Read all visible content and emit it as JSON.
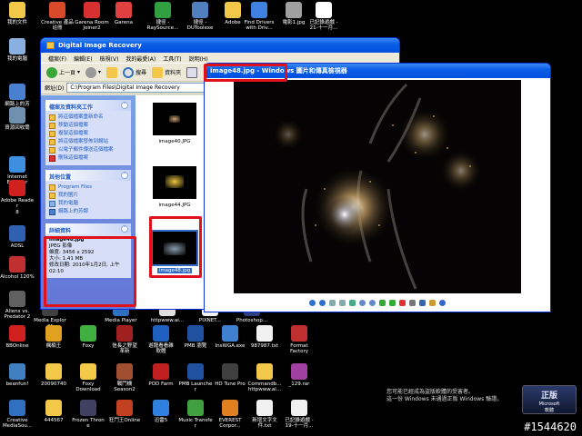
{
  "desktop": {
    "icons_top": [
      {
        "label": "我的文件",
        "color": "#f3c748",
        "icon": "folder-icon"
      },
      {
        "label": "Creative 產品\n註冊",
        "color": "#d84a2a",
        "icon": "creative-icon"
      },
      {
        "label": "Garena Room\nJoiner2",
        "color": "#d83030",
        "icon": "garena-icon"
      },
      {
        "label": "Garena",
        "color": "#e04040",
        "icon": "garena-icon"
      },
      {
        "label": "捷徑 -\nRaySource...",
        "color": "#30a040",
        "icon": "shortcut-icon"
      },
      {
        "label": "捷徑 -\nDUToolexe",
        "color": "#5080c0",
        "icon": "shortcut-icon"
      },
      {
        "label": "Adobe",
        "color": "#f3c748",
        "icon": "folder-icon"
      },
      {
        "label": "Find Drivers\nwith Driv...",
        "color": "#4080e0",
        "icon": "driver-icon"
      },
      {
        "label": "電影1.jpg",
        "color": "#a0a0a0",
        "icon": "image-file-icon"
      },
      {
        "label": "已記錄遊戲 -\n21-十一月...",
        "color": "#ffffff",
        "icon": "text-file-icon"
      }
    ],
    "icons_left": [
      {
        "label": "我的電腦",
        "color": "#8ab0e0",
        "icon": "computer-icon"
      },
      {
        "label": "網路上的芳\n鄰",
        "color": "#4a80d0",
        "icon": "network-icon"
      },
      {
        "label": "資源回收筒",
        "color": "#7090b0",
        "icon": "recycle-bin-icon"
      },
      {
        "label": "Internet\nExplorer",
        "color": "#3f8fe0",
        "icon": "ie-icon"
      },
      {
        "label": "Adobe Reader\n8",
        "color": "#d02020",
        "icon": "adobe-reader-icon"
      },
      {
        "label": "ADSL",
        "color": "#3060b0",
        "icon": "adsl-icon"
      },
      {
        "label": "Alcohol 120%",
        "color": "#c03030",
        "icon": "alcohol-icon"
      },
      {
        "label": "Aliens vs.\nPredator 2",
        "color": "#606060",
        "icon": "game-icon"
      }
    ],
    "icons_row1": [
      {
        "label": "Media Explorer",
        "color": "#404040",
        "icon": "media-explorer-icon"
      },
      {
        "label": "Media Player",
        "color": "#3070c0",
        "icon": "media-player-icon"
      },
      {
        "label": "httpwww.ai...",
        "color": "#e0e0e0",
        "icon": "web-shortcut-icon"
      },
      {
        "label": "PIXNET...",
        "color": "#f0f0f0",
        "icon": "shortcut-icon"
      },
      {
        "label": "Photoshop...",
        "color": "#304080",
        "icon": "photoshop-icon"
      }
    ],
    "icons_row2": [
      {
        "label": "BBOnline",
        "color": "#d02020",
        "icon": "bbonline-icon"
      },
      {
        "label": "楓楠王",
        "color": "#e0a020",
        "icon": "game-icon"
      },
      {
        "label": "Foxy",
        "color": "#40b040",
        "icon": "foxy-icon"
      },
      {
        "label": "信長之野望\n革新",
        "color": "#a02020",
        "icon": "game-icon"
      },
      {
        "label": "遊龍看看雜\n軟體",
        "color": "#2060c0",
        "icon": "game-icon"
      },
      {
        "label": "PMB 瀏覽",
        "color": "#2050a0",
        "icon": "pmb-icon"
      },
      {
        "label": "InsWGA.exe",
        "color": "#4080d0",
        "icon": "exe-icon"
      },
      {
        "label": "987987.txt",
        "color": "#f0f0f0",
        "icon": "text-file-icon"
      },
      {
        "label": "Format\nFactory",
        "color": "#c03030",
        "icon": "format-factory-icon"
      }
    ],
    "icons_row3": [
      {
        "label": "beanfun!",
        "color": "#4080c0",
        "icon": "beanfun-icon"
      },
      {
        "label": "20090740",
        "color": "#f3c748",
        "icon": "folder-icon"
      },
      {
        "label": "Foxy\nDownload",
        "color": "#f3c748",
        "icon": "folder-icon"
      },
      {
        "label": "戰鬥機\nSeason2",
        "color": "#a05030",
        "icon": "game-icon"
      },
      {
        "label": "POD Farm",
        "color": "#c02020",
        "icon": "pod-icon"
      },
      {
        "label": "PMB Launcher",
        "color": "#2050a0",
        "icon": "pmb-icon"
      },
      {
        "label": "HD Tune Pro",
        "color": "#404040",
        "icon": "hdtune-icon"
      },
      {
        "label": "Commandb...\nhttpwww.ai...",
        "color": "#f3c748",
        "icon": "folder-icon"
      },
      {
        "label": "_129.rar",
        "color": "#a040a0",
        "icon": "rar-icon"
      }
    ],
    "icons_row4": [
      {
        "label": "Creative\nMediaSou...",
        "color": "#3070c0",
        "icon": "creative-icon"
      },
      {
        "label": "444567",
        "color": "#f3c748",
        "icon": "folder-icon"
      },
      {
        "label": "Frozen Throne",
        "color": "#404060",
        "icon": "game-icon"
      },
      {
        "label": "狂鬥王Online",
        "color": "#c04020",
        "icon": "game-icon"
      },
      {
        "label": "迅雷5",
        "color": "#3080e0",
        "icon": "thunder-icon"
      },
      {
        "label": "Music Transfer",
        "color": "#40a040",
        "icon": "music-icon"
      },
      {
        "label": "EVEREST\nCorpor...",
        "color": "#e08020",
        "icon": "everest-icon"
      },
      {
        "label": "新增文字文\n件.txt",
        "color": "#f0f0f0",
        "icon": "text-file-icon"
      },
      {
        "label": "已記錄遊戲 -\n19-十一月...",
        "color": "#f0f0f0",
        "icon": "text-file-icon"
      }
    ]
  },
  "explorer": {
    "title": "Digital Image Recovery",
    "menu": [
      "檔案(F)",
      "編輯(E)",
      "檢視(V)",
      "我的最愛(A)",
      "工具(T)",
      "說明(H)"
    ],
    "toolbar": {
      "back": "上一頁",
      "search": "搜尋",
      "folders": "資料夾"
    },
    "address_label": "網址(D)",
    "address_value": "C:\\Program Files\\Digital Image Recovery",
    "tasks_panel": {
      "title": "檔案及資料夾工作",
      "items": [
        "將這個檔案重新命名",
        "移動這個檔案",
        "複製這個檔案",
        "將這個檔案發佈到網站",
        "以電子郵件傳送這個檔案",
        "刪除這個檔案"
      ]
    },
    "other_places": {
      "title": "其他位置",
      "items": [
        "Program Files",
        "我的圖片",
        "我的電腦",
        "網路上的芳鄰"
      ]
    },
    "details": {
      "title": "詳細資料",
      "filename": "image48.jpg",
      "type": "JPEG 影像",
      "dimensions": "維度: 3456 x 2592",
      "size": "大小: 1.41 MB",
      "modified": "修改日期: 2010年1月2日, 上午 02:10"
    },
    "thumbnails": [
      "image40.JPG",
      "image44.JPG",
      "image48.jpg"
    ]
  },
  "viewer": {
    "title": "image48.jpg - Windows 圖片和傳真檢視器"
  },
  "genuine": {
    "line1": "您可能已經成為盜版軟體的受害者。",
    "line2": "這一份 Windows 未通過正版 Windows 驗證。",
    "logo_big": "正版",
    "logo_small": "Microsoft\n軟體"
  },
  "post_id": "#1544620"
}
